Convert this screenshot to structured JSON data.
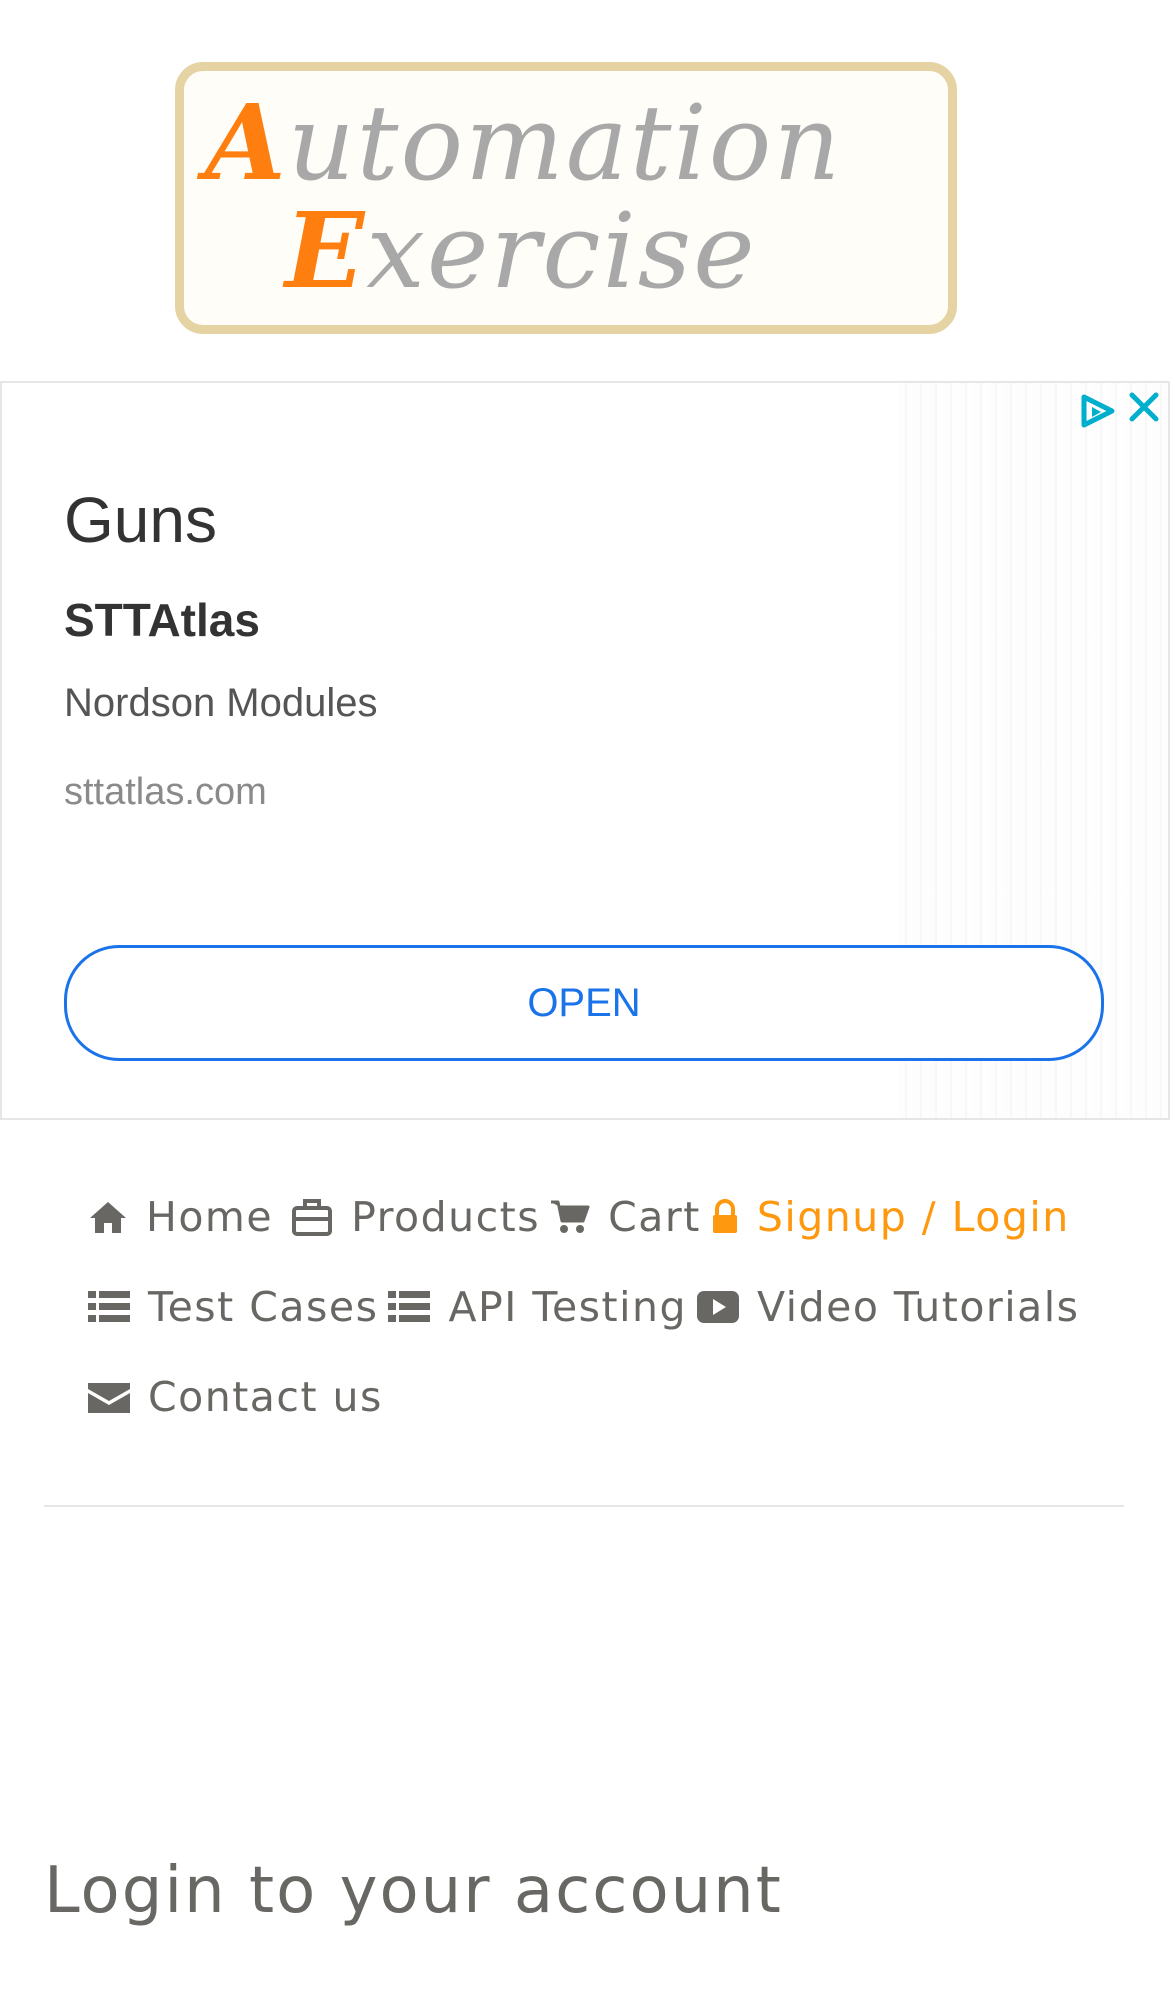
{
  "logo": {
    "line1_cap": "A",
    "line1_rest": "utomation",
    "line2_cap": "E",
    "line2_rest": "xercise"
  },
  "ad": {
    "title": "Guns",
    "brand": "STTAtlas",
    "description": "Nordson Modules",
    "url": "sttatlas.com",
    "cta": "OPEN",
    "accent_color": "#1a73e8"
  },
  "nav": {
    "items": [
      {
        "label": "Home",
        "icon": "home-icon"
      },
      {
        "label": "Products",
        "icon": "briefcase-icon"
      },
      {
        "label": "Cart",
        "icon": "shopping-cart-icon"
      },
      {
        "label": "Signup / Login",
        "icon": "lock-icon",
        "active": true
      },
      {
        "label": "Test Cases",
        "icon": "list-icon"
      },
      {
        "label": "API Testing",
        "icon": "list-icon"
      },
      {
        "label": "Video Tutorials",
        "icon": "youtube-play-icon"
      },
      {
        "label": "Contact us",
        "icon": "envelope-icon"
      }
    ],
    "active_color": "#fe980f"
  },
  "login": {
    "title": "Login to your account"
  }
}
